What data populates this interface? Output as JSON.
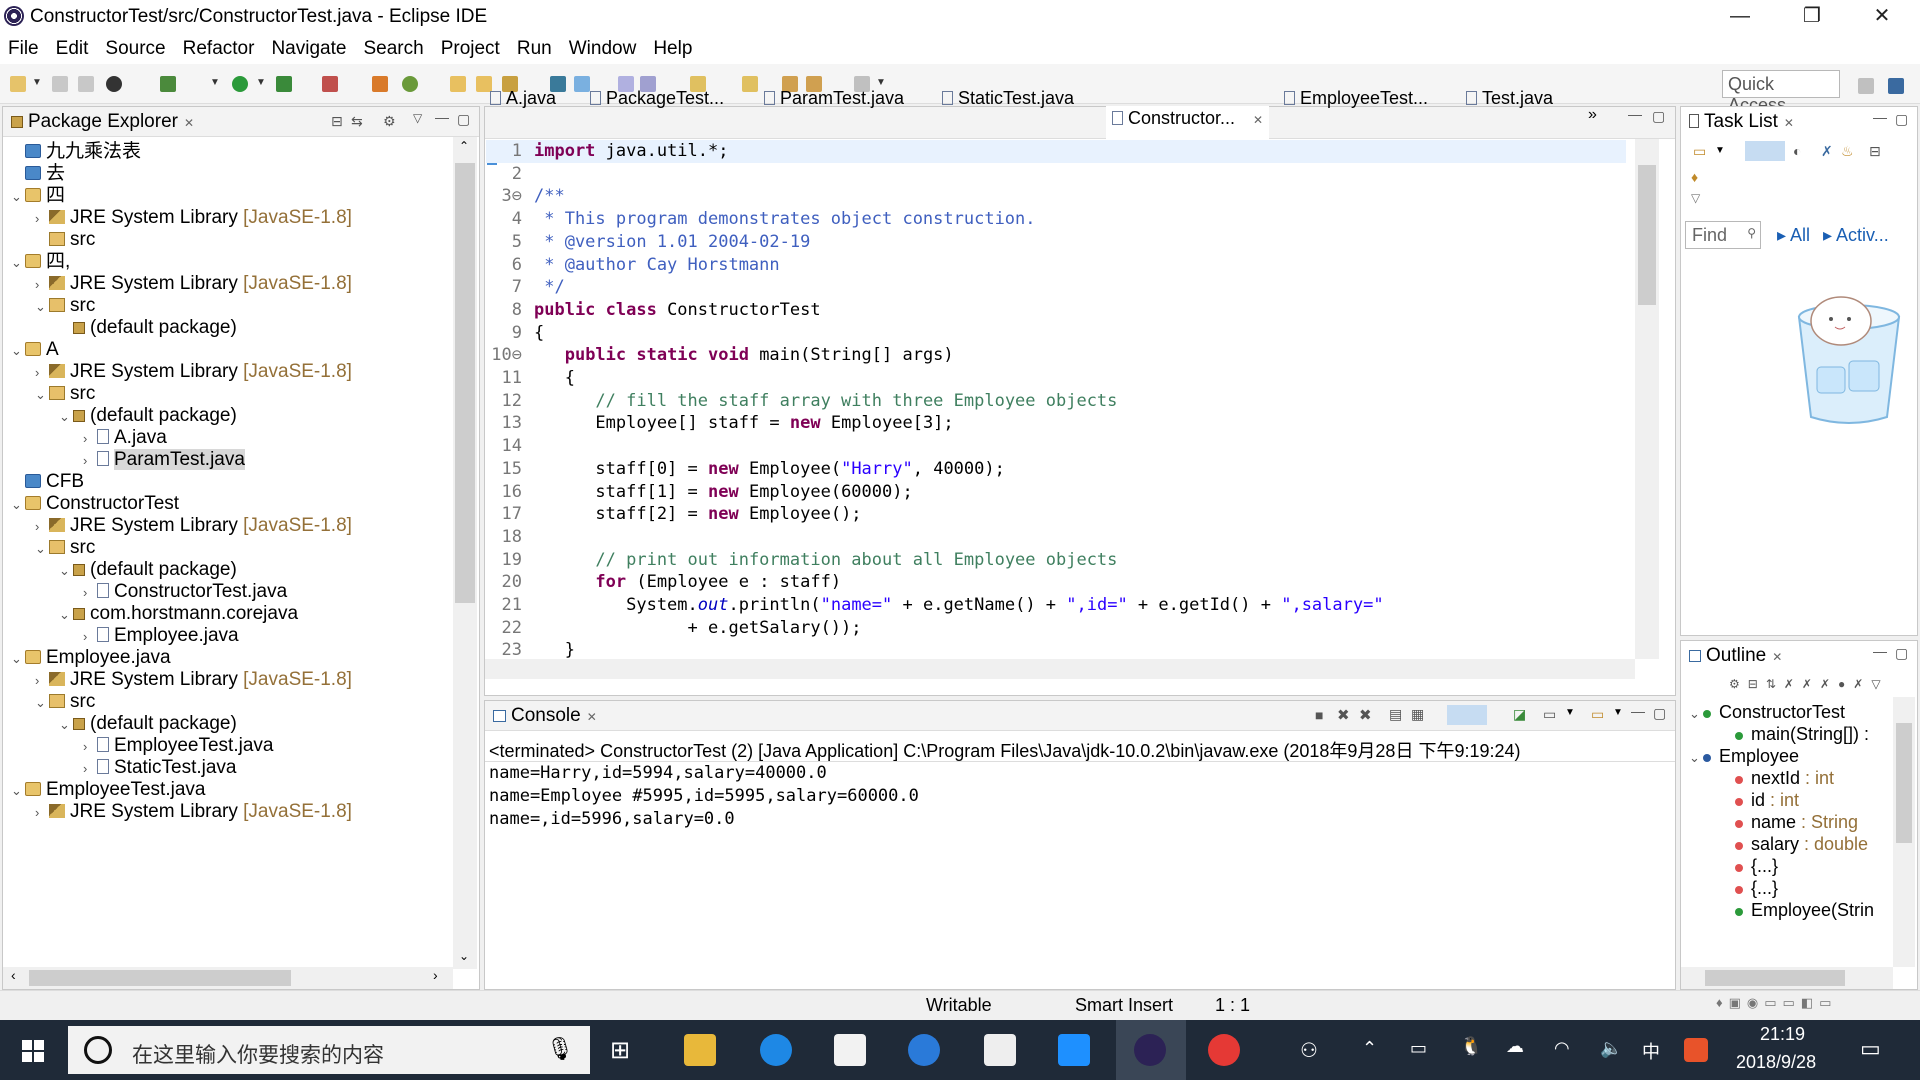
{
  "window": {
    "title": "ConstructorTest/src/ConstructorTest.java - Eclipse IDE",
    "min": "—",
    "max": "❐",
    "close": "✕"
  },
  "menu": [
    "File",
    "Edit",
    "Source",
    "Refactor",
    "Navigate",
    "Search",
    "Project",
    "Run",
    "Window",
    "Help"
  ],
  "quick_access": "Quick Access",
  "package_explorer": {
    "title": "Package Explorer",
    "items": [
      {
        "label": "九九乘法表",
        "lib": "",
        "icon": "proj2",
        "chev": ""
      },
      {
        "label": "去",
        "lib": "",
        "icon": "proj2",
        "chev": ""
      },
      {
        "label": "四",
        "lib": "",
        "icon": "proj",
        "chev": "⌄"
      },
      {
        "label": "JRE System Library ",
        "lib": "[JavaSE-1.8]",
        "icon": "jar",
        "chev": "›"
      },
      {
        "label": "src",
        "lib": "",
        "icon": "src",
        "chev": ""
      },
      {
        "label": "四,",
        "lib": "",
        "icon": "proj",
        "chev": "⌄"
      },
      {
        "label": "JRE System Library ",
        "lib": "[JavaSE-1.8]",
        "icon": "jar",
        "chev": "›"
      },
      {
        "label": "src",
        "lib": "",
        "icon": "src",
        "chev": "⌄"
      },
      {
        "label": "(default package)",
        "lib": "",
        "icon": "pkg",
        "chev": ""
      },
      {
        "label": "A",
        "lib": "",
        "icon": "proj",
        "chev": "⌄"
      },
      {
        "label": "JRE System Library ",
        "lib": "[JavaSE-1.8]",
        "icon": "jar",
        "chev": "›"
      },
      {
        "label": "src",
        "lib": "",
        "icon": "src",
        "chev": "⌄"
      },
      {
        "label": "(default package)",
        "lib": "",
        "icon": "pkg",
        "chev": "⌄"
      },
      {
        "label": "A.java",
        "lib": "",
        "icon": "java",
        "chev": "›"
      },
      {
        "label": "ParamTest.java",
        "lib": "",
        "icon": "java",
        "chev": "›"
      },
      {
        "label": "CFB",
        "lib": "",
        "icon": "proj2",
        "chev": ""
      },
      {
        "label": "ConstructorTest",
        "lib": "",
        "icon": "proj",
        "chev": "⌄"
      },
      {
        "label": "JRE System Library ",
        "lib": "[JavaSE-1.8]",
        "icon": "jar",
        "chev": "›"
      },
      {
        "label": "src",
        "lib": "",
        "icon": "src",
        "chev": "⌄"
      },
      {
        "label": "(default package)",
        "lib": "",
        "icon": "pkg",
        "chev": "⌄"
      },
      {
        "label": "ConstructorTest.java",
        "lib": "",
        "icon": "java",
        "chev": "›"
      },
      {
        "label": "com.horstmann.corejava",
        "lib": "",
        "icon": "pkg",
        "chev": "⌄"
      },
      {
        "label": "Employee.java",
        "lib": "",
        "icon": "java",
        "chev": "›"
      },
      {
        "label": "Employee.java",
        "lib": "",
        "icon": "proj",
        "chev": "⌄"
      },
      {
        "label": "JRE System Library ",
        "lib": "[JavaSE-1.8]",
        "icon": "jar",
        "chev": "›"
      },
      {
        "label": "src",
        "lib": "",
        "icon": "src",
        "chev": "⌄"
      },
      {
        "label": "(default package)",
        "lib": "",
        "icon": "pkg",
        "chev": "⌄"
      },
      {
        "label": "EmployeeTest.java",
        "lib": "",
        "icon": "java",
        "chev": "›"
      },
      {
        "label": "StaticTest.java",
        "lib": "",
        "icon": "java",
        "chev": "›"
      },
      {
        "label": "EmployeeTest.java",
        "lib": "",
        "icon": "proj",
        "chev": "⌄"
      },
      {
        "label": "JRE System Library ",
        "lib": "[JavaSE-1.8]",
        "icon": "jar",
        "chev": "›"
      }
    ]
  },
  "editor": {
    "tabs": [
      "A.java",
      "PackageTest...",
      "ParamTest.java",
      "StaticTest.java",
      "Constructor...",
      "EmployeeTest...",
      "Test.java"
    ],
    "active_tab": "Constructor...",
    "overflow": "»",
    "lines": [
      {
        "n": "1",
        "segs": [
          [
            "kw",
            "import"
          ],
          [
            "",
            " java.util.*;"
          ]
        ]
      },
      {
        "n": "2",
        "segs": []
      },
      {
        "n": "3⊖",
        "segs": [
          [
            "cm",
            "/**"
          ]
        ]
      },
      {
        "n": "4",
        "segs": [
          [
            "cm",
            " * This program demonstrates object construction."
          ]
        ]
      },
      {
        "n": "5",
        "segs": [
          [
            "cm",
            " * @version 1.01 2004-02-19"
          ]
        ]
      },
      {
        "n": "6",
        "segs": [
          [
            "cm",
            " * @author Cay Horstmann"
          ]
        ]
      },
      {
        "n": "7",
        "segs": [
          [
            "cm",
            " */"
          ]
        ]
      },
      {
        "n": "8",
        "segs": [
          [
            "kw",
            "public class"
          ],
          [
            "",
            " ConstructorTest"
          ]
        ]
      },
      {
        "n": "9",
        "segs": [
          [
            "",
            "{"
          ]
        ]
      },
      {
        "n": "10⊖",
        "segs": [
          [
            "",
            "   "
          ],
          [
            "kw",
            "public static void"
          ],
          [
            "",
            " main(String[] args)"
          ]
        ]
      },
      {
        "n": "11",
        "segs": [
          [
            "",
            "   {"
          ]
        ]
      },
      {
        "n": "12",
        "segs": [
          [
            "",
            "      "
          ],
          [
            "cmt",
            "// fill the staff array with three Employee objects"
          ]
        ]
      },
      {
        "n": "13",
        "segs": [
          [
            "",
            "      Employee[] staff = "
          ],
          [
            "kw",
            "new"
          ],
          [
            "",
            " Employee[3];"
          ]
        ]
      },
      {
        "n": "14",
        "segs": []
      },
      {
        "n": "15",
        "segs": [
          [
            "",
            "      staff[0] = "
          ],
          [
            "kw",
            "new"
          ],
          [
            "",
            " Employee("
          ],
          [
            "str",
            "\"Harry\""
          ],
          [
            "",
            ", 40000);"
          ]
        ]
      },
      {
        "n": "16",
        "segs": [
          [
            "",
            "      staff[1] = "
          ],
          [
            "kw",
            "new"
          ],
          [
            "",
            " Employee(60000);"
          ]
        ]
      },
      {
        "n": "17",
        "segs": [
          [
            "",
            "      staff[2] = "
          ],
          [
            "kw",
            "new"
          ],
          [
            "",
            " Employee();"
          ]
        ]
      },
      {
        "n": "18",
        "segs": []
      },
      {
        "n": "19",
        "segs": [
          [
            "",
            "      "
          ],
          [
            "cmt",
            "// print out information about all Employee objects"
          ]
        ]
      },
      {
        "n": "20",
        "segs": [
          [
            "",
            "      "
          ],
          [
            "kw",
            "for"
          ],
          [
            "",
            " (Employee e : staff)"
          ]
        ]
      },
      {
        "n": "21",
        "segs": [
          [
            "",
            "         System."
          ],
          [
            "it",
            "out"
          ],
          [
            "",
            ".println("
          ],
          [
            "str",
            "\"name=\""
          ],
          [
            "",
            " + e.getName() + "
          ],
          [
            "str",
            "\",id=\""
          ],
          [
            "",
            " + e.getId() + "
          ],
          [
            "str",
            "\",salary=\""
          ]
        ]
      },
      {
        "n": "22",
        "segs": [
          [
            "",
            "               + e.getSalary());"
          ]
        ]
      },
      {
        "n": "23",
        "segs": [
          [
            "",
            "   }"
          ]
        ]
      }
    ]
  },
  "console": {
    "title": "Console",
    "header": "<terminated> ConstructorTest (2) [Java Application] C:\\Program Files\\Java\\jdk-10.0.2\\bin\\javaw.exe (2018年9月28日 下午9:19:24)",
    "lines": [
      "name=Harry,id=5994,salary=40000.0",
      "name=Employee #5995,id=5995,salary=60000.0",
      "name=,id=5996,salary=0.0"
    ]
  },
  "task_list": {
    "title": "Task List",
    "find": "Find",
    "all": "All",
    "activ": "Activ..."
  },
  "outline": {
    "title": "Outline",
    "items": [
      {
        "label": "ConstructorTest",
        "type": "",
        "depth": 0,
        "chev": "⌄"
      },
      {
        "label": "main(String[]) :",
        "type": "",
        "depth": 1,
        "chev": ""
      },
      {
        "label": "Employee",
        "type": "",
        "depth": 0,
        "chev": "⌄"
      },
      {
        "label": "nextId",
        "type": " : int",
        "depth": 1,
        "chev": ""
      },
      {
        "label": "id",
        "type": " : int",
        "depth": 1,
        "chev": ""
      },
      {
        "label": "name",
        "type": " : String",
        "depth": 1,
        "chev": ""
      },
      {
        "label": "salary",
        "type": " : double",
        "depth": 1,
        "chev": ""
      },
      {
        "label": "{...}",
        "type": "",
        "depth": 1,
        "chev": ""
      },
      {
        "label": "{...}",
        "type": "",
        "depth": 1,
        "chev": ""
      },
      {
        "label": "Employee(Strin",
        "type": "",
        "depth": 1,
        "chev": ""
      }
    ]
  },
  "status": {
    "writable": "Writable",
    "insert": "Smart Insert",
    "pos": "1 : 1"
  },
  "taskbar": {
    "search_placeholder": "在这里输入你要搜索的内容",
    "time": "21:19",
    "date": "2018/9/28",
    "ime": "中"
  }
}
